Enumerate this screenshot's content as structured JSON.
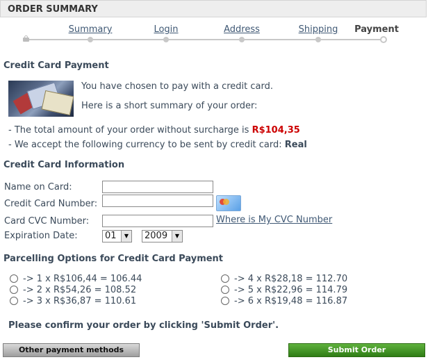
{
  "header": {
    "title": "ORDER SUMMARY"
  },
  "steps": [
    {
      "label": "Summary",
      "current": false
    },
    {
      "label": "Login",
      "current": false
    },
    {
      "label": "Address",
      "current": false
    },
    {
      "label": "Shipping",
      "current": false
    },
    {
      "label": "Payment",
      "current": true
    }
  ],
  "payment": {
    "title": "Credit Card Payment",
    "intro": "You have chosen to pay with a credit card.",
    "summary_intro": "Here is a short summary of your order:",
    "total_text": "- The total amount of your order without surcharge is ",
    "total_amount": "R$104,35",
    "currency_text": "- We accept the following currency to be sent by credit card: ",
    "currency": "Real"
  },
  "card_info": {
    "title": "Credit Card Information",
    "name_label": "Name on Card:",
    "number_label": "Credit Card Number:",
    "cvc_label": "Card CVC Number:",
    "cvc_link": "Where is My CVC Number",
    "expiration_label": "Expiration Date:",
    "month": "01",
    "year": "2009"
  },
  "parcelling": {
    "title": "Parcelling Options for Credit Card Payment",
    "options": [
      "-> 1 x R$106,44 = 106.44",
      "-> 2 x R$54,26 = 108.52",
      "-> 3 x R$36,87 = 110.61",
      "-> 4 x R$28,18 = 112.70",
      "-> 5 x R$22,96 = 114.79",
      "-> 6 x R$19,48 = 116.87"
    ]
  },
  "confirm_text": "Please confirm your order by clicking 'Submit Order'.",
  "buttons": {
    "other_methods": "Other payment methods",
    "submit": "Submit Order"
  }
}
